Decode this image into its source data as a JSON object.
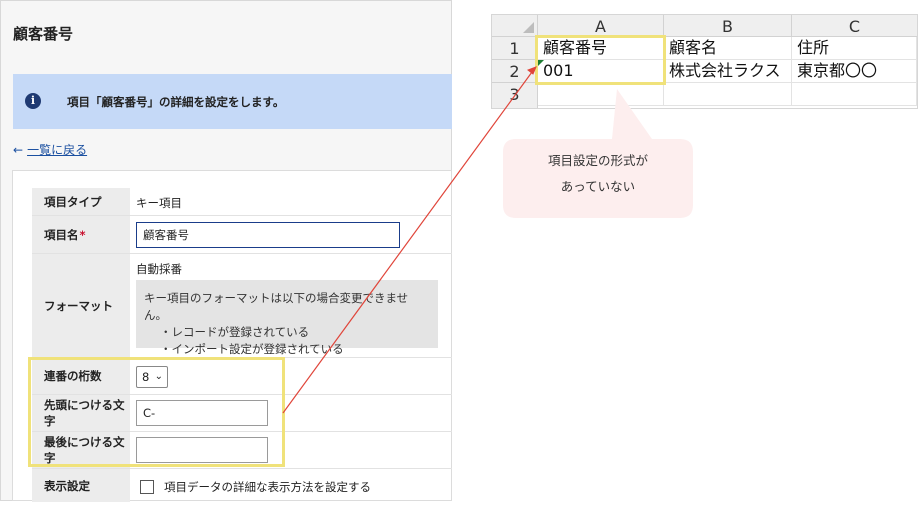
{
  "panel": {
    "title": "顧客番号",
    "info_icon": "i",
    "info_text": "項目「顧客番号」の詳細を設定をします。",
    "back_arrow": "←",
    "back_link": "一覧に戻る"
  },
  "form": {
    "item_type": {
      "label": "項目タイプ",
      "value": "キー項目"
    },
    "item_name": {
      "label": "項目名",
      "required_mark": "*",
      "value": "顧客番号"
    },
    "format": {
      "label": "フォーマット",
      "value": "自動採番",
      "note_line1": "キー項目のフォーマットは以下の場合変更できません。",
      "note_line2": "・レコードが登録されている",
      "note_line3": "・インポート設定が登録されている"
    },
    "digits": {
      "label": "連番の桁数",
      "value": "8",
      "chevron": "⌄"
    },
    "prefix": {
      "label": "先頭につける文字",
      "value": "C-"
    },
    "suffix": {
      "label": "最後につける文字",
      "value": ""
    },
    "display": {
      "label": "表示設定",
      "checkbox_label": "項目データの詳細な表示方法を設定する",
      "checked": false
    }
  },
  "sheet": {
    "columns": [
      "A",
      "B",
      "C"
    ],
    "rows": [
      "1",
      "2",
      "3"
    ],
    "cells": [
      [
        "顧客番号",
        "顧客名",
        "住所"
      ],
      [
        "001",
        "株式会社ラクス",
        "東京都〇〇"
      ],
      [
        "",
        "",
        ""
      ]
    ]
  },
  "callout": {
    "line1": "項目設定の形式が",
    "line2": "あっていない"
  },
  "colors": {
    "highlight": "#f0e27a",
    "arrow": "#e0453a",
    "callout_bg": "#fdeeee",
    "banner_bg": "#c5d9f7"
  }
}
